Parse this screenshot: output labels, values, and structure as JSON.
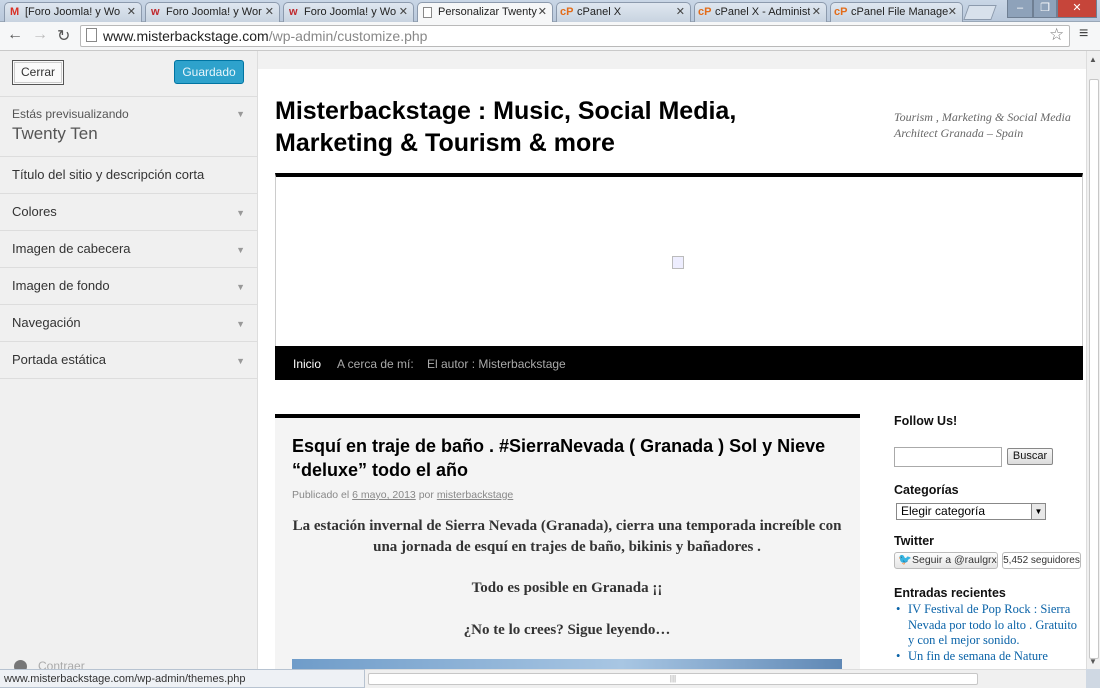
{
  "browser": {
    "tabs": [
      {
        "favicon": "M",
        "favicon_color": "#d93025",
        "label": "[Foro Joomla! y Wo",
        "active": false
      },
      {
        "favicon": "w",
        "favicon_color": "#c0282d",
        "label": "Foro Joomla! y Wor",
        "active": false
      },
      {
        "favicon": "w",
        "favicon_color": "#c0282d",
        "label": "Foro Joomla! y Wo",
        "active": false
      },
      {
        "favicon": "",
        "favicon_color": "#666666",
        "label": "Personalizar Twenty",
        "active": true
      },
      {
        "favicon": "cP",
        "favicon_color": "#e36c1a",
        "label": "cPanel X",
        "active": false
      },
      {
        "favicon": "cP",
        "favicon_color": "#e36c1a",
        "label": "cPanel X - Administ",
        "active": false
      },
      {
        "favicon": "cP",
        "favicon_color": "#e36c1a",
        "label": "cPanel File Manage",
        "active": false
      }
    ],
    "url_host": "www.misterbackstage.com",
    "url_path": "/wp-admin/customize.php",
    "status_url": "www.misterbackstage.com/wp-admin/themes.php"
  },
  "customizer": {
    "close_label": "Cerrar",
    "save_label": "Guardado",
    "preview_label": "Estás previsualizando",
    "theme_name": "Twenty Ten",
    "sections": [
      "Título del sitio y descripción corta",
      "Colores",
      "Imagen de cabecera",
      "Imagen de fondo",
      "Navegación",
      "Portada estática"
    ],
    "collapse_label": "Contraer"
  },
  "site": {
    "title": "Misterbackstage : Music, Social Media, Marketing & Tourism & more",
    "description": "Tourism , Marketing & Social Media Architect Granada – Spain",
    "menu": [
      "Inicio",
      "A cerca de mí:",
      "El autor : Misterbackstage"
    ],
    "post": {
      "title": "Esquí en traje de baño . #SierraNevada ( Granada ) Sol y Nieve “deluxe” todo el año",
      "meta_prefix": "Publicado el",
      "date": "6 mayo, 2013",
      "meta_by": "por",
      "author": "misterbackstage",
      "paragraphs": [
        "La estación invernal de Sierra Nevada (Granada), cierra una temporada increíble con una jornada de esquí en trajes de baño, bikinis y bañadores .",
        "Todo es posible en Granada ¡¡",
        "¿No te lo crees? Sigue leyendo…"
      ]
    },
    "widgets": {
      "follow_title": "Follow Us!",
      "search_button": "Buscar",
      "categories_title": "Categorías",
      "categories_selected": "Elegir categoría",
      "twitter_title": "Twitter",
      "twitter_follow": "Seguir a @raulgrx",
      "twitter_followers": "5,452 seguidores",
      "recent_title": "Entradas recientes",
      "recent_posts": [
        "IV Festival de Pop Rock : Sierra Nevada por todo lo alto . Gratuito y con el mejor sonido.",
        "Un fin de semana de Nature"
      ]
    }
  }
}
